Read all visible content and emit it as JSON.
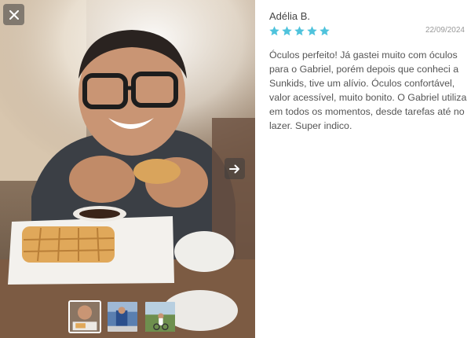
{
  "review": {
    "author": "Adélia B.",
    "rating": 5,
    "max_rating": 5,
    "date": "22/09/2024",
    "text": "Óculos perfeito! Já gastei muito com óculos para o Gabriel, porém depois que conheci a Sunkids, tive um alívio. Óculos confortável, valor acessível, muito bonito. O Gabriel utiliza em todos os momentos, desde tarefas até no lazer. Super indico."
  },
  "gallery": {
    "close_icon": "close-icon",
    "next_icon": "arrow-right-icon",
    "selected_index": 0,
    "thumbnail_count": 3
  },
  "colors": {
    "star": "#4fc3dc",
    "overlay_button": "#3c3c3c",
    "text": "#555555",
    "date": "#999999"
  }
}
